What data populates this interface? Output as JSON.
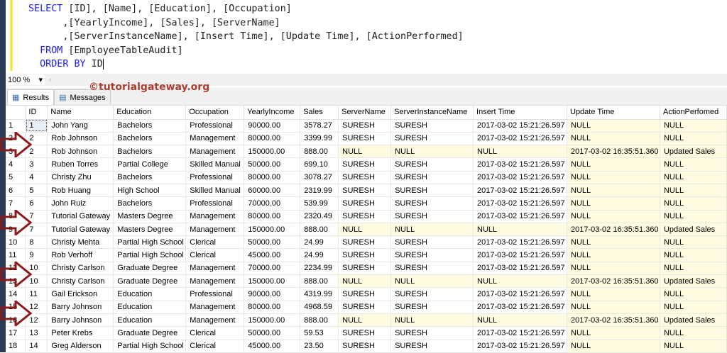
{
  "query": {
    "lines": [
      [
        {
          "k": "SELECT"
        },
        {
          "t": " [ID], [Name], [Education], [Occupation]"
        }
      ],
      [
        {
          "t": "      ,[YearlyIncome], [Sales], [ServerName]"
        }
      ],
      [
        {
          "t": "      ,[ServerInstanceName], [Insert Time], [Update Time], [ActionPerformed]"
        }
      ],
      [
        {
          "t": "  "
        },
        {
          "k": "FROM"
        },
        {
          "t": " [EmployeeTableAudit]"
        }
      ],
      [
        {
          "t": "  "
        },
        {
          "k": "ORDER BY"
        },
        {
          "t": " ID"
        }
      ]
    ]
  },
  "zoom": {
    "value": "100 %"
  },
  "watermark": "©tutorialgateway.org",
  "tabs": [
    {
      "label": "Results",
      "icon": "grid-icon"
    },
    {
      "label": "Messages",
      "icon": "messages-icon"
    }
  ],
  "columns": [
    "",
    "ID",
    "Name",
    "Education",
    "Occupation",
    "YearlyIncome",
    "Sales",
    "ServerName",
    "ServerInstanceName",
    "Insert Time",
    "Update Time",
    "ActionPerfomed"
  ],
  "rows": [
    [
      "1",
      "1",
      "John Yang",
      "Bachelors",
      "Professional",
      "90000.00",
      "3578.27",
      "SURESH",
      "SURESH",
      "2017-03-02 15:21:26.597",
      "NULL",
      "NULL"
    ],
    [
      "2",
      "2",
      "Rob Johnson",
      "Bachelors",
      "Management",
      "80000.00",
      "3399.99",
      "SURESH",
      "SURESH",
      "2017-03-02 15:21:26.597",
      "NULL",
      "NULL"
    ],
    [
      "3",
      "2",
      "Rob Johnson",
      "Bachelors",
      "Management",
      "150000.00",
      "888.00",
      "NULL",
      "NULL",
      "NULL",
      "2017-03-02 16:35:51.360",
      "Updated Sales"
    ],
    [
      "4",
      "3",
      "Ruben Torres",
      "Partial College",
      "Skilled Manual",
      "50000.00",
      "699.10",
      "SURESH",
      "SURESH",
      "2017-03-02 15:21:26.597",
      "NULL",
      "NULL"
    ],
    [
      "5",
      "4",
      "Christy Zhu",
      "Bachelors",
      "Professional",
      "80000.00",
      "3078.27",
      "SURESH",
      "SURESH",
      "2017-03-02 15:21:26.597",
      "NULL",
      "NULL"
    ],
    [
      "6",
      "5",
      "Rob Huang",
      "High School",
      "Skilled Manual",
      "60000.00",
      "2319.99",
      "SURESH",
      "SURESH",
      "2017-03-02 15:21:26.597",
      "NULL",
      "NULL"
    ],
    [
      "7",
      "6",
      "John Ruiz",
      "Bachelors",
      "Professional",
      "70000.00",
      "539.99",
      "SURESH",
      "SURESH",
      "2017-03-02 15:21:26.597",
      "NULL",
      "NULL"
    ],
    [
      "8",
      "7",
      "Tutorial Gateway",
      "Masters Degree",
      "Management",
      "80000.00",
      "2320.49",
      "SURESH",
      "SURESH",
      "2017-03-02 15:21:26.597",
      "NULL",
      "NULL"
    ],
    [
      "9",
      "7",
      "Tutorial Gateway",
      "Masters Degree",
      "Management",
      "150000.00",
      "888.00",
      "NULL",
      "NULL",
      "NULL",
      "2017-03-02 16:35:51.360",
      "Updated Sales"
    ],
    [
      "10",
      "8",
      "Christy Mehta",
      "Partial High School",
      "Clerical",
      "50000.00",
      "24.99",
      "SURESH",
      "SURESH",
      "2017-03-02 15:21:26.597",
      "NULL",
      "NULL"
    ],
    [
      "11",
      "9",
      "Rob Verhoff",
      "Partial High School",
      "Clerical",
      "45000.00",
      "24.99",
      "SURESH",
      "SURESH",
      "2017-03-02 15:21:26.597",
      "NULL",
      "NULL"
    ],
    [
      "12",
      "10",
      "Christy Carlson",
      "Graduate Degree",
      "Management",
      "70000.00",
      "2234.99",
      "SURESH",
      "SURESH",
      "2017-03-02 15:21:26.597",
      "NULL",
      "NULL"
    ],
    [
      "13",
      "10",
      "Christy Carlson",
      "Graduate Degree",
      "Management",
      "150000.00",
      "888.00",
      "NULL",
      "NULL",
      "NULL",
      "2017-03-02 16:35:51.360",
      "Updated Sales"
    ],
    [
      "14",
      "11",
      "Gail Erickson",
      "Education",
      "Professional",
      "90000.00",
      "4319.99",
      "SURESH",
      "SURESH",
      "2017-03-02 15:21:26.597",
      "NULL",
      "NULL"
    ],
    [
      "15",
      "12",
      "Barry Johnson",
      "Education",
      "Management",
      "80000.00",
      "4968.59",
      "SURESH",
      "SURESH",
      "2017-03-02 15:21:26.597",
      "NULL",
      "NULL"
    ],
    [
      "16",
      "12",
      "Barry Johnson",
      "Education",
      "Management",
      "150000.00",
      "888.00",
      "NULL",
      "NULL",
      "NULL",
      "2017-03-02 16:35:51.360",
      "Updated Sales"
    ],
    [
      "17",
      "13",
      "Peter Krebs",
      "Graduate Degree",
      "Clerical",
      "50000.00",
      "59.53",
      "SURESH",
      "SURESH",
      "2017-03-02 15:21:26.597",
      "NULL",
      "NULL"
    ],
    [
      "18",
      "14",
      "Greg Alderson",
      "Partial High School",
      "Clerical",
      "45000.00",
      "23.50",
      "SURESH",
      "SURESH",
      "2017-03-02 15:21:26.597",
      "NULL",
      "NULL"
    ]
  ],
  "highlighted_row_pairs": [
    [
      2,
      3
    ],
    [
      8,
      9
    ],
    [
      12,
      13
    ],
    [
      15,
      16
    ]
  ],
  "colors": {
    "null_bg": "#fffbe0",
    "arrow": "#8b1a1a",
    "keyword": "#1a1aff"
  }
}
